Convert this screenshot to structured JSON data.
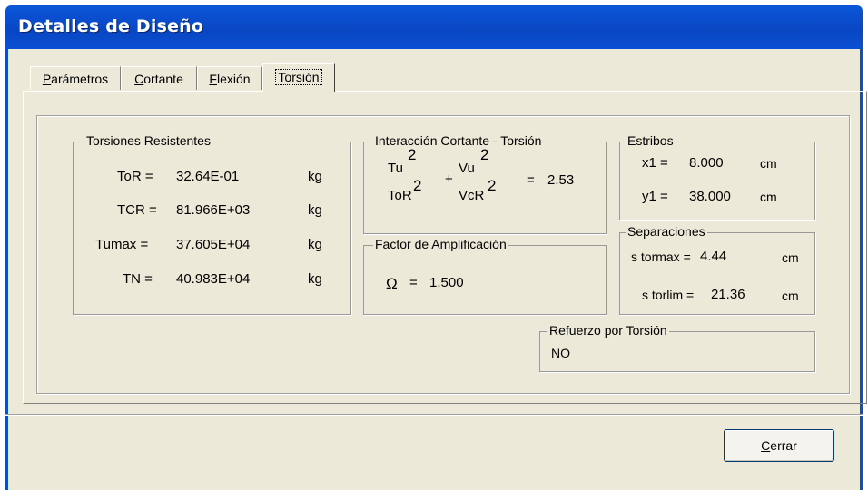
{
  "window": {
    "title": "Detalles de Diseño"
  },
  "tabs": [
    {
      "mnemonic": "P",
      "rest": "arámetros"
    },
    {
      "mnemonic": "C",
      "rest": "ortante"
    },
    {
      "mnemonic": "F",
      "rest": "lexión"
    },
    {
      "mnemonic": "T",
      "rest": "orsión"
    }
  ],
  "active_tab": "Torsión",
  "torsiones": {
    "title": "Torsiones Resistentes",
    "rows": [
      {
        "label": "ToR =",
        "value": "32.64E-01",
        "unit": "kg"
      },
      {
        "label": "TCR =",
        "value": "81.966E+03",
        "unit": "kg"
      },
      {
        "label": "Tumax =",
        "value": "37.605E+04",
        "unit": "kg"
      },
      {
        "label": "TN =",
        "value": "40.983E+04",
        "unit": "kg"
      }
    ]
  },
  "interaccion": {
    "title": "Interacción Cortante - Torsión",
    "num1": "Tu",
    "den1": "ToR",
    "exp": "2",
    "plus": "+",
    "num2": "Vu",
    "den2": "VcR",
    "eq": "=",
    "result": "2.53"
  },
  "factor": {
    "title": "Factor de Amplificación",
    "symbol": "Ω",
    "eq": "=",
    "value": "1.500"
  },
  "estribos": {
    "title": "Estribos",
    "rows": [
      {
        "label": "x1 =",
        "value": "8.000",
        "unit": "cm"
      },
      {
        "label": "y1 =",
        "value": "38.000",
        "unit": "cm"
      }
    ]
  },
  "separaciones": {
    "title": "Separaciones",
    "rows": [
      {
        "label": "s tormax =",
        "value": "4.44",
        "unit": "cm"
      },
      {
        "label": "s torlim =",
        "value": "21.36",
        "unit": "cm"
      }
    ]
  },
  "refuerzo": {
    "title": "Refuerzo por Torsión",
    "value": "NO"
  },
  "close_button": {
    "mnemonic": "C",
    "rest": "errar"
  }
}
